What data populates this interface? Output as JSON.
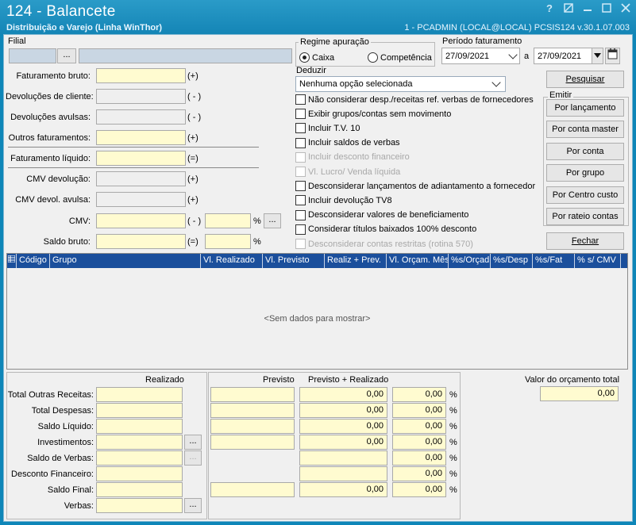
{
  "window": {
    "title": "124 - Balancete",
    "subtitle": "Distribuição e Varejo (Linha WinThor)",
    "session": "1 - PCADMIN (LOCAL@LOCAL)   PCSIS124  v.30.1.07.003",
    "help": "?"
  },
  "filial": {
    "label": "Filial",
    "code": "",
    "browse_label": "...",
    "name": ""
  },
  "left_fields": [
    {
      "label": "Faturamento bruto:",
      "value": "",
      "sign": "(+)"
    },
    {
      "label": "Devoluções de cliente:",
      "value": "",
      "sign": "( - )"
    },
    {
      "label": "Devoluções avulsas:",
      "value": "",
      "sign": "( - )"
    },
    {
      "label": "Outros faturamentos:",
      "value": "",
      "sign": "(+)"
    },
    {
      "label": "Faturamento líquido:",
      "value": "",
      "sign": "(=)"
    },
    {
      "label": "CMV devolução:",
      "value": "",
      "sign": "(+)"
    },
    {
      "label": "CMV devol. avulsa:",
      "value": "",
      "sign": "(+)"
    }
  ],
  "cmv": {
    "label": "CMV:",
    "value": "",
    "sign": "( - )",
    "percent_value": "",
    "percent": "%",
    "browse_label": "..."
  },
  "saldo_bruto": {
    "label": "Saldo bruto:",
    "value": "",
    "sign": "(=)",
    "percent_value": "",
    "percent": "%"
  },
  "regime": {
    "title": "Regime apuração",
    "options": [
      {
        "label": "Caixa",
        "selected": true
      },
      {
        "label": "Competência",
        "selected": false
      }
    ]
  },
  "periodo": {
    "title": "Período faturamento",
    "from": "27/09/2021",
    "sep": "a",
    "to": "27/09/2021"
  },
  "deduzir": {
    "label": "Deduzir",
    "value": "Nenhuma opção selecionada"
  },
  "options": [
    {
      "label": "Não considerar desp./receitas ref. verbas de fornecedores",
      "enabled": true
    },
    {
      "label": "Exibir grupos/contas sem movimento",
      "enabled": true
    },
    {
      "label": "Incluir T.V. 10",
      "enabled": true
    },
    {
      "label": "Incluir saldos de verbas",
      "enabled": true
    },
    {
      "label": "Incluir desconto financeiro",
      "enabled": false
    },
    {
      "label": "Vl. Lucro/ Venda líquida",
      "enabled": false
    },
    {
      "label": "Desconsiderar lançamentos de adiantamento a fornecedor",
      "enabled": true
    },
    {
      "label": "Incluir devolução TV8",
      "enabled": true
    },
    {
      "label": "Desconsiderar valores de beneficiamento",
      "enabled": true
    },
    {
      "label": "Considerar títulos baixados 100% desconto",
      "enabled": true
    },
    {
      "label": "Desconsiderar contas restritas (rotina 570)",
      "enabled": false
    }
  ],
  "actions": {
    "pesquisar": "Pesquisar",
    "emitir_title": "Emitir",
    "emitir": [
      "Por lançamento",
      "Por conta master",
      "Por conta",
      "Por grupo",
      "Por Centro custo",
      "Por rateio contas"
    ],
    "fechar": "Fechar"
  },
  "grid": {
    "columns": [
      "Código",
      "Grupo",
      "Vl. Realizado",
      "Vl. Previsto",
      "Realiz + Prev.",
      "Vl. Orçam. Mês",
      "%s/Orçad",
      "%s/Desp",
      "%s/Fat",
      "% s/ CMV"
    ],
    "empty": "<Sem dados para mostrar>"
  },
  "totals": {
    "head_realizado": "Realizado",
    "head_previsto": "Previsto",
    "head_prev_real": "Previsto + Realizado",
    "browse_label": "...",
    "percent": "%",
    "rows": [
      {
        "label": "Total Outras Receitas:",
        "realizado": "",
        "previsto": "",
        "prev_real": "0,00",
        "pct": "0,00"
      },
      {
        "label": "Total Despesas:",
        "realizado": "",
        "previsto": "",
        "prev_real": "0,00",
        "pct": "0,00"
      },
      {
        "label": "Saldo Líquido:",
        "realizado": "",
        "previsto": "",
        "prev_real": "0,00",
        "pct": "0,00"
      },
      {
        "label": "Investimentos:",
        "realizado": "",
        "previsto": "",
        "prev_real": "0,00",
        "pct": "0,00"
      },
      {
        "label": "Saldo de Verbas:",
        "realizado": "",
        "previsto": "",
        "prev_real": "",
        "pct": "0,00"
      },
      {
        "label": "Desconto Financeiro:",
        "realizado": "",
        "previsto": "",
        "prev_real": "",
        "pct": "0,00"
      },
      {
        "label": "Saldo Final:",
        "realizado": "",
        "previsto": "",
        "prev_real": "0,00",
        "pct": "0,00"
      },
      {
        "label": "Verbas:",
        "realizado": "",
        "previsto": "",
        "prev_real": "",
        "pct": ""
      }
    ],
    "orcamento_label": "Valor do orçamento total",
    "orcamento_value": "0,00"
  }
}
